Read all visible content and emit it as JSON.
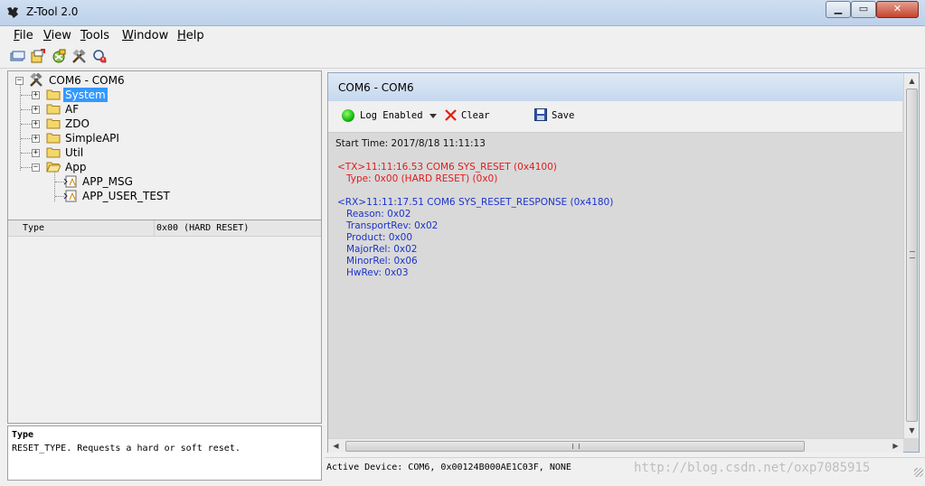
{
  "window": {
    "title": "Z-Tool 2.0"
  },
  "menu": [
    {
      "label": "File",
      "accel": "F",
      "rest": "ile"
    },
    {
      "label": "View",
      "accel": "V",
      "rest": "iew"
    },
    {
      "label": "Tools",
      "accel": "T",
      "rest": "ools"
    },
    {
      "label": "Window",
      "accel": "W",
      "rest": "indow"
    },
    {
      "label": "Help",
      "accel": "H",
      "rest": "elp"
    }
  ],
  "toolbar_icons": [
    "open-device-icon",
    "new-device-icon",
    "configure-icon",
    "tools-icon",
    "search-icon"
  ],
  "tree": {
    "root": "COM6 - COM6",
    "folders": [
      "System",
      "AF",
      "ZDO",
      "SimpleAPI",
      "Util",
      "App"
    ],
    "selected": "System",
    "app_children": [
      "APP_MSG",
      "APP_USER_TEST"
    ]
  },
  "properties": {
    "name": "Type",
    "value": "0x00 (HARD RESET)"
  },
  "description": {
    "title": "Type",
    "text": "RESET_TYPE.  Requests a hard or soft reset."
  },
  "document": {
    "title": "COM6 - COM6",
    "toolbar": {
      "log_enabled": "Log Enabled",
      "clear": "Clear",
      "save": "Save"
    },
    "log": {
      "start": "Start Time: 2017/8/18 11:11:13",
      "tx_header": "<TX>11:11:16.53 COM6 SYS_RESET (0x4100)",
      "tx_fields": [
        "Type: 0x00 (HARD RESET) (0x0)"
      ],
      "rx_header": "<RX>11:11:17.51 COM6 SYS_RESET_RESPONSE (0x4180)",
      "rx_fields": [
        "Reason: 0x02",
        "TransportRev: 0x02",
        "Product: 0x00",
        "MajorRel: 0x02",
        "MinorRel: 0x06",
        "HwRev: 0x03"
      ]
    }
  },
  "status": {
    "active_device": "Active Device: COM6, 0x00124B000AE1C03F, NONE",
    "watermark": "http://blog.csdn.net/oxp7085915"
  },
  "colors": {
    "tx": "#e21b1b",
    "rx": "#1c33cc",
    "selection": "#3399ff"
  }
}
